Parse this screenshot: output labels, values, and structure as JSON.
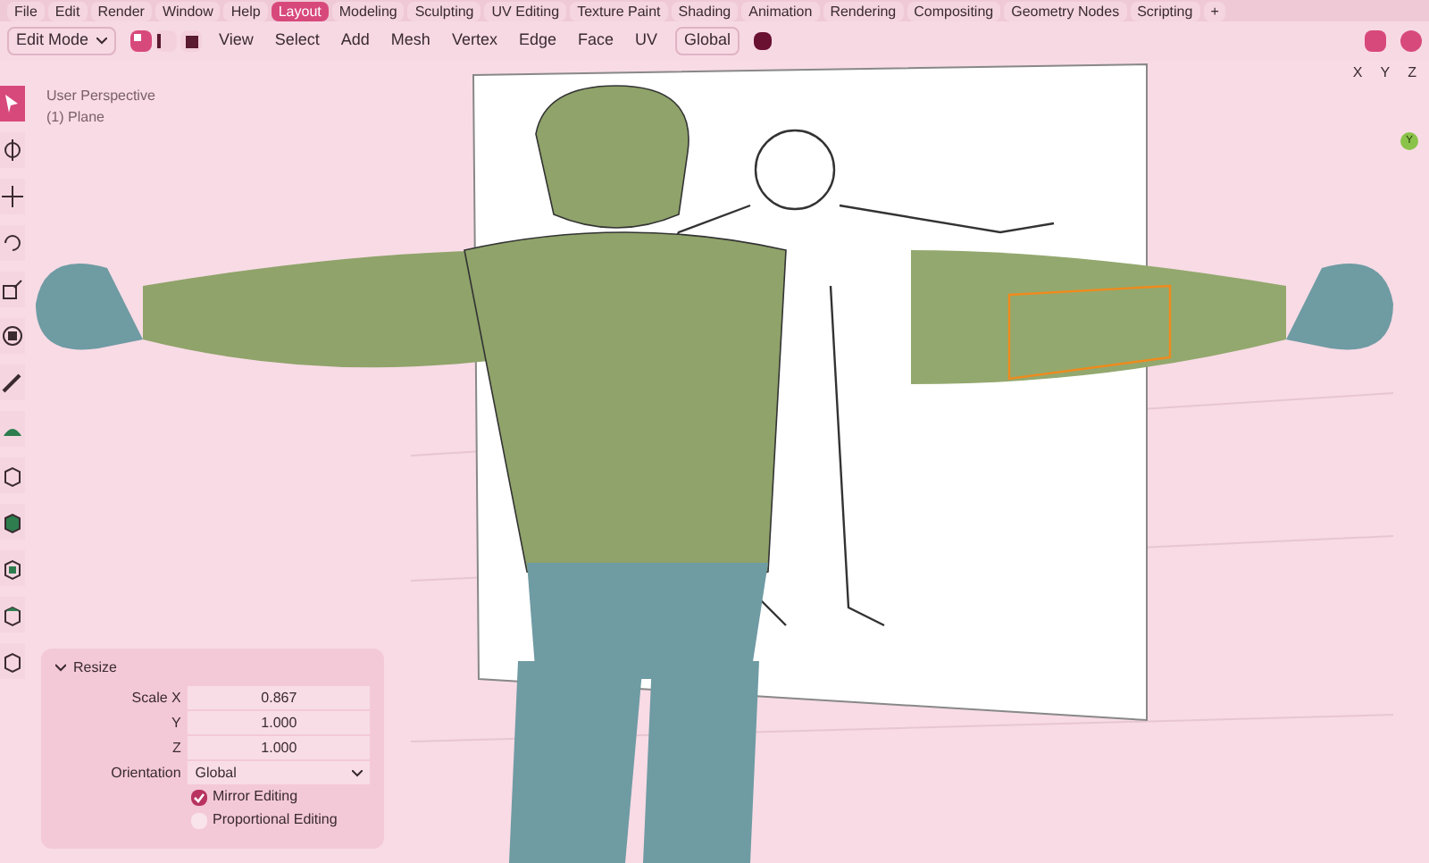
{
  "workspace_tabs": [
    {
      "label": "File",
      "selected": false
    },
    {
      "label": "Edit",
      "selected": false
    },
    {
      "label": "Render",
      "selected": false
    },
    {
      "label": "Window",
      "selected": false
    },
    {
      "label": "Help",
      "selected": false
    },
    {
      "label": "Layout",
      "selected": true
    },
    {
      "label": "Modeling",
      "selected": false
    },
    {
      "label": "Sculpting",
      "selected": false
    },
    {
      "label": "UV Editing",
      "selected": false
    },
    {
      "label": "Texture Paint",
      "selected": false
    },
    {
      "label": "Shading",
      "selected": false
    },
    {
      "label": "Animation",
      "selected": false
    },
    {
      "label": "Rendering",
      "selected": false
    },
    {
      "label": "Compositing",
      "selected": false
    },
    {
      "label": "Geometry Nodes",
      "selected": false
    },
    {
      "label": "Scripting",
      "selected": false
    },
    {
      "label": "+",
      "selected": false
    }
  ],
  "header": {
    "mode": "Edit Mode",
    "select_modes": [
      {
        "kind": "vertex",
        "selected": true
      },
      {
        "kind": "edge",
        "selected": false
      },
      {
        "kind": "face",
        "selected": false
      }
    ],
    "menus": [
      "View",
      "Select",
      "Add",
      "Mesh",
      "Vertex",
      "Edge",
      "Face",
      "UV"
    ],
    "orientation": "Global"
  },
  "mirror_axes": [
    {
      "label": "X",
      "selected": false
    },
    {
      "label": "Y",
      "selected": false
    },
    {
      "label": "Z",
      "selected": false
    }
  ],
  "toolbar": [
    {
      "kind": "select",
      "selected": true
    },
    {
      "kind": "cursor",
      "selected": false
    },
    {
      "kind": "move",
      "selected": false
    },
    {
      "kind": "rotate",
      "selected": false
    },
    {
      "kind": "scale",
      "selected": false
    },
    {
      "kind": "transform",
      "selected": false
    },
    {
      "kind": "annotate",
      "selected": false
    },
    {
      "kind": "measure",
      "selected": false
    },
    {
      "kind": "cube",
      "selected": false
    },
    {
      "kind": "extrude",
      "selected": false
    },
    {
      "kind": "inset",
      "selected": false
    },
    {
      "kind": "bevel",
      "selected": false
    },
    {
      "kind": "cube",
      "selected": false
    }
  ],
  "viewport": {
    "view_name": "User Perspective",
    "object": "(1) Plane",
    "axis_label": "Y"
  },
  "resize_panel": {
    "title": "Resize",
    "expanded": true,
    "fields": [
      {
        "label": "Scale X",
        "value": "0.867"
      },
      {
        "label": "Y",
        "value": "1.000"
      },
      {
        "label": "Z",
        "value": "1.000"
      }
    ],
    "orientation_label": "Orientation",
    "orientation": "Global",
    "options": [
      {
        "label": "Mirror Editing",
        "checked": true
      },
      {
        "label": "Proportional Editing",
        "checked": false
      }
    ]
  }
}
